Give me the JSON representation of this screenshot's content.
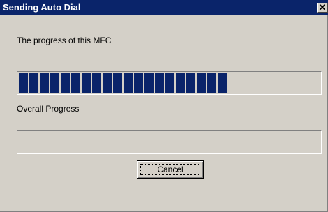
{
  "window": {
    "title": "Sending Auto Dial",
    "close_glyph": "✕"
  },
  "task_progress": {
    "label": "The progress of this MFC",
    "fraction": 0.69
  },
  "overall_progress": {
    "label": "Overall Progress",
    "fraction": 0
  },
  "buttons": {
    "cancel": "Cancel"
  },
  "colors": {
    "titlebar": "#0a246a",
    "progress_fill": "#0a246a",
    "dialog_face": "#d4d0c8"
  }
}
